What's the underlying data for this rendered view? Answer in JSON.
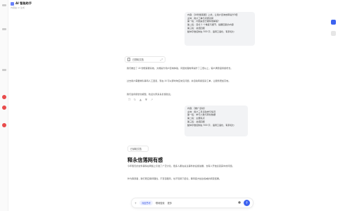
{
  "app": {
    "title": "AI 智能助手",
    "subtitle": "内容由 AI 生成"
  },
  "messages": {
    "user_1": "内容：【AI智能客服】上线，让用户咨询效率提升3倍\n主体：用户工单与问题对接\n第一段：问题是否已被有效解答？\n第二段：目标 1 个维度与细节，提醒回复的内容\n第三段：总结回报\n整体字数控制在 500 字，语调口语化，有亲和力",
    "file_1": "已提取文档",
    "answer_p1": "我们推出了 AI 智能客服系统，大幅提升用户咨询体验，问题处理效率提升了三倍以上，客户满意度持续增长。",
    "answer_p2": "过去用户需要排队等待人工回复，现在 AI 可以即时响应常见问题，并自动转接复杂工单，让服务更加高效。",
    "answer_p3": "我们会持续优化模型，欢迎大家多多反馈建议。",
    "user_2": "内容：【推广活动】\n主体：用户三月活动参与情况\n第一段：参与人数与转化数据\n第二段：主要亮点\n第三段：总结回报\n整体字数控制在 500 字，语调口语化，有亲和力",
    "file_2": "已读取文档",
    "heading": "释永信落网有感",
    "answer_p4": "今年春天的这件事情在网络上引发了广泛讨论，很多人都在关注事件的后续进展，也有人开始反思其中的问题。",
    "answer_p5": "作为旁观者，我们更应保持理性，不盲目跟风，也不轻易下结论，等待官方给出权威的调查结果。"
  },
  "composer": {
    "chip_deep": "深度思考",
    "chip_web": "联网搜索",
    "chip_more": "更多"
  },
  "colors": {
    "accent": "#3d63f0",
    "badge_red": "#e84c4c",
    "bubble_bg": "#f2f3f5"
  },
  "icons": {
    "send": "arrow-up-icon",
    "mic": "microphone-icon",
    "expand": "expand-icon",
    "file": "file-icon"
  }
}
